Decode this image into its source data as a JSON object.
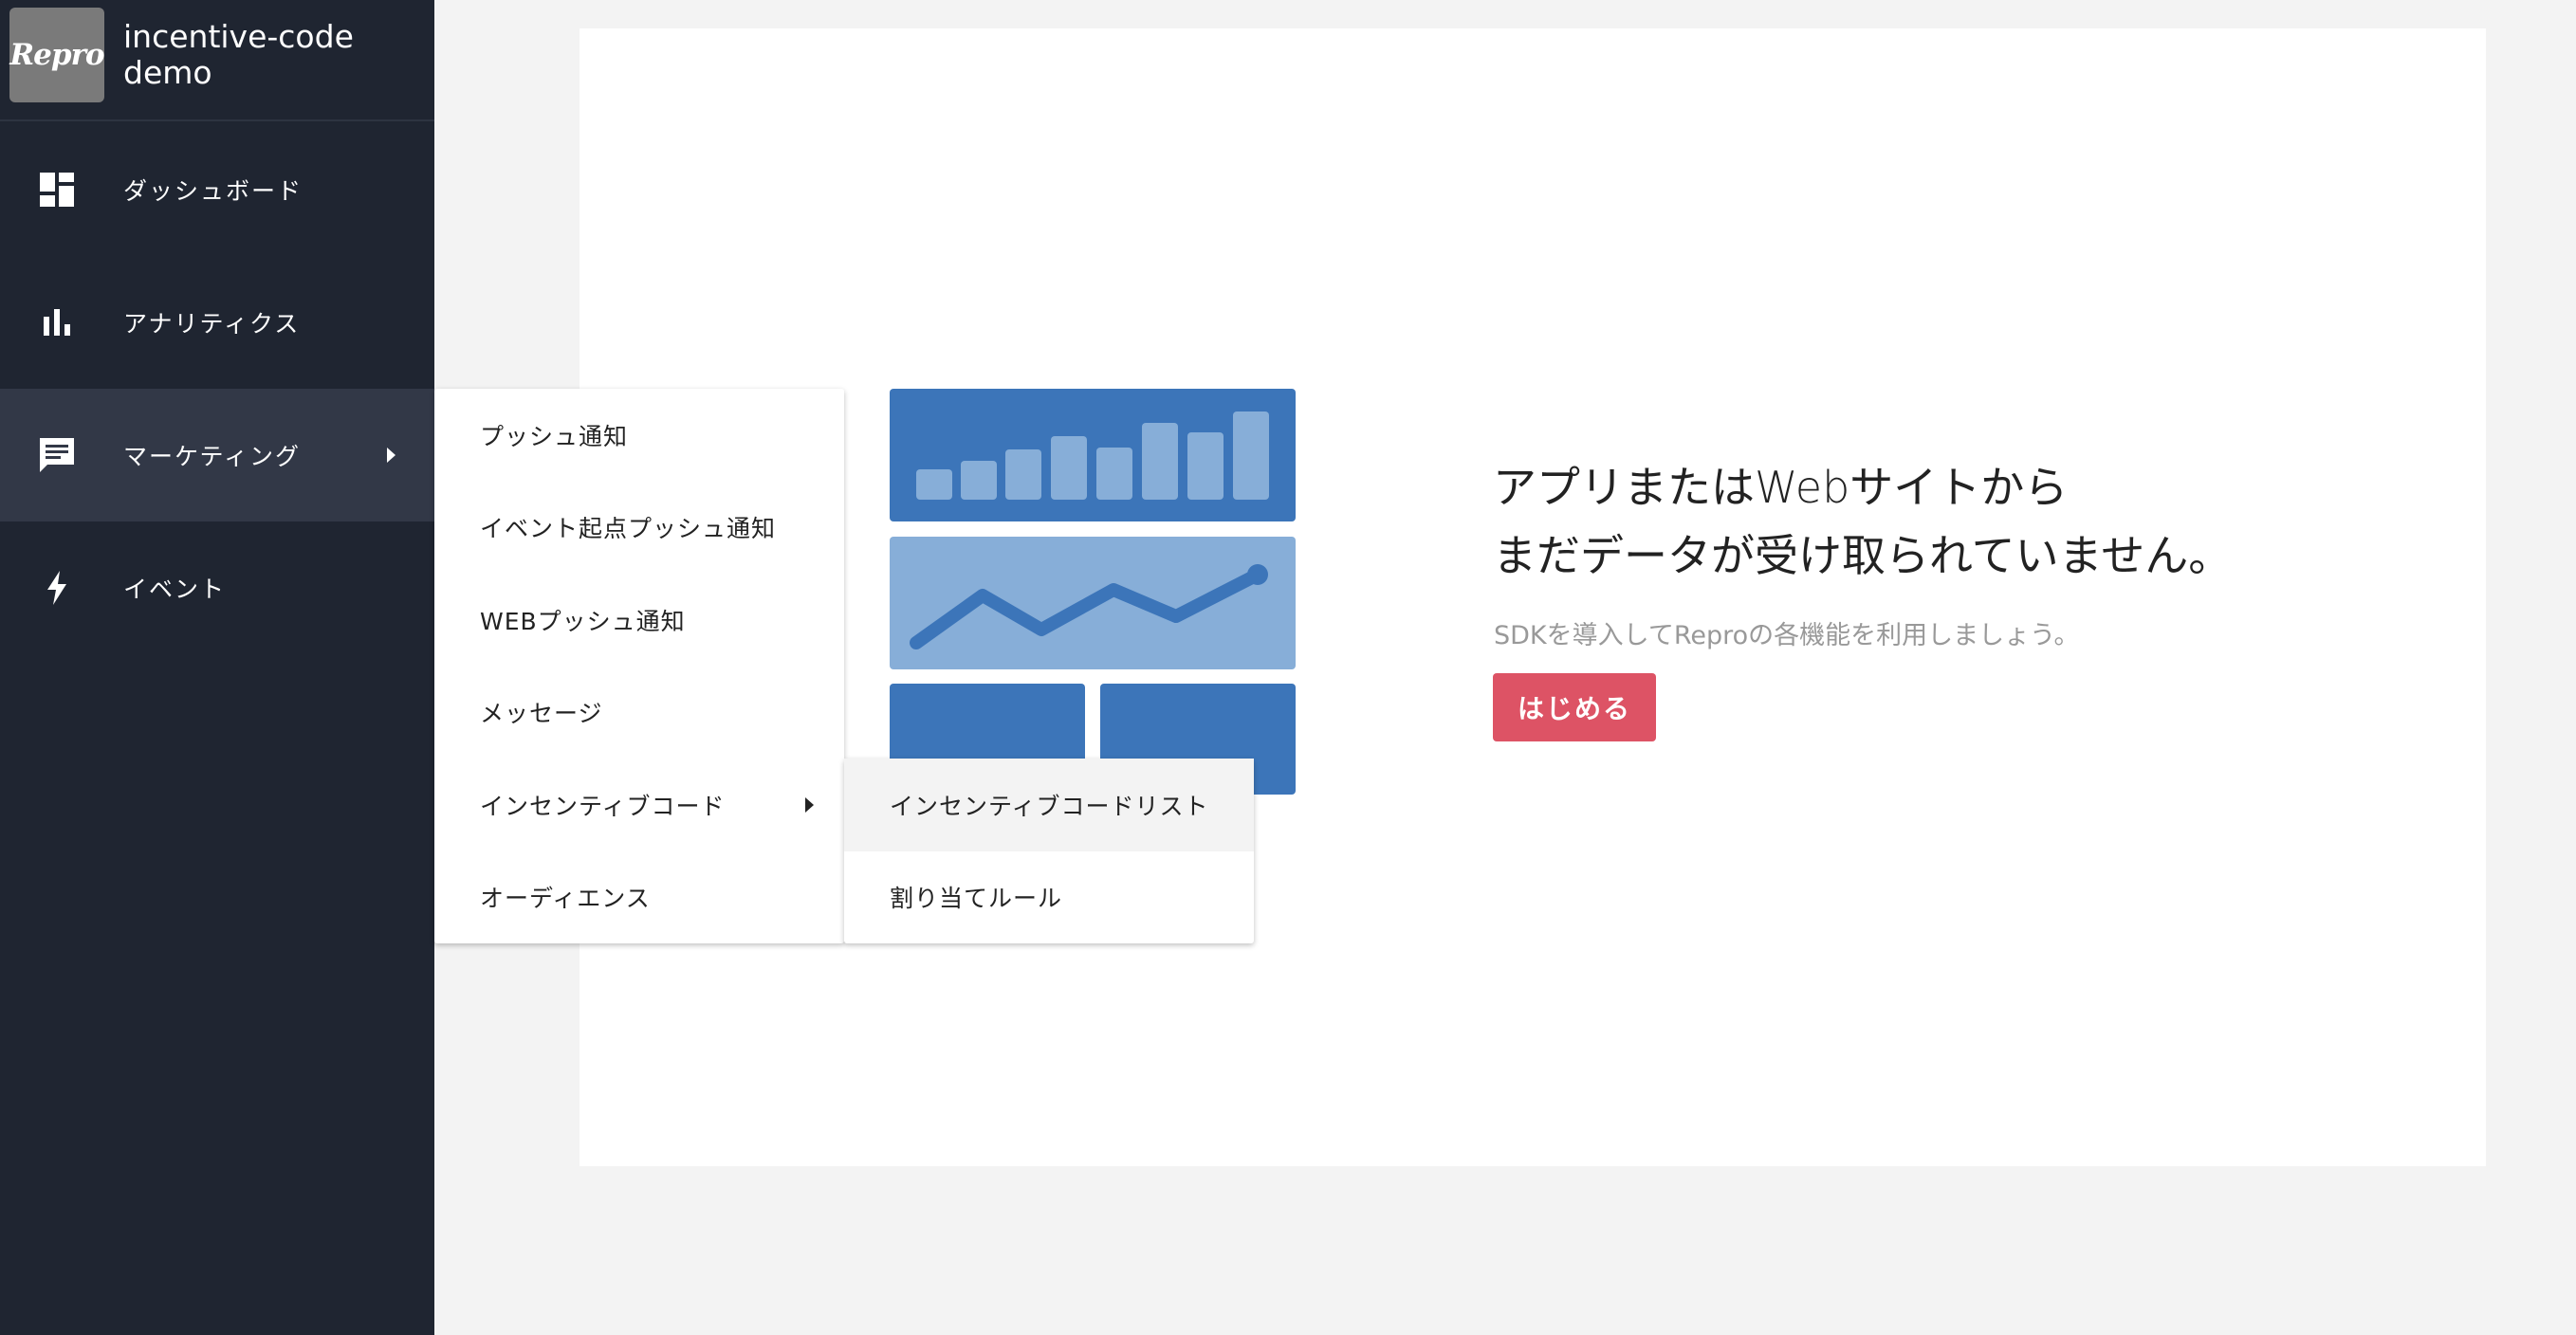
{
  "app": {
    "logo_text": "Repro",
    "name_line1": "incentive-code",
    "name_line2": "demo"
  },
  "sidebar": {
    "items": [
      {
        "label": "ダッシュボード",
        "icon": "dashboard-icon"
      },
      {
        "label": "アナリティクス",
        "icon": "bar-chart-icon"
      },
      {
        "label": "マーケティング",
        "icon": "chat-message-icon",
        "active": true
      },
      {
        "label": "イベント",
        "icon": "lightning-bolt-icon"
      }
    ]
  },
  "marketing_menu": {
    "items": [
      {
        "label": "プッシュ通知"
      },
      {
        "label": "イベント起点プッシュ通知"
      },
      {
        "label": "WEBプッシュ通知"
      },
      {
        "label": "メッセージ"
      },
      {
        "label": "インセンティブコード",
        "has_submenu": true
      },
      {
        "label": "オーディエンス"
      }
    ]
  },
  "incentive_menu": {
    "items": [
      {
        "label": "インセンティブコードリスト",
        "highlighted": true
      },
      {
        "label": "割り当てルール"
      }
    ]
  },
  "empty_state": {
    "title_line1": "アプリまたはWebサイトから",
    "title_line2": "まだデータが受け取られていません。",
    "subtitle": "SDKを導入してReproの各機能を利用しましょう。",
    "button_label": "はじめる"
  },
  "colors": {
    "sidebar_bg": "#1f2531",
    "sidebar_active": "#323847",
    "accent_button": "#dd5365",
    "illustration_dark": "#3c75b9",
    "illustration_light": "#87aed8"
  }
}
